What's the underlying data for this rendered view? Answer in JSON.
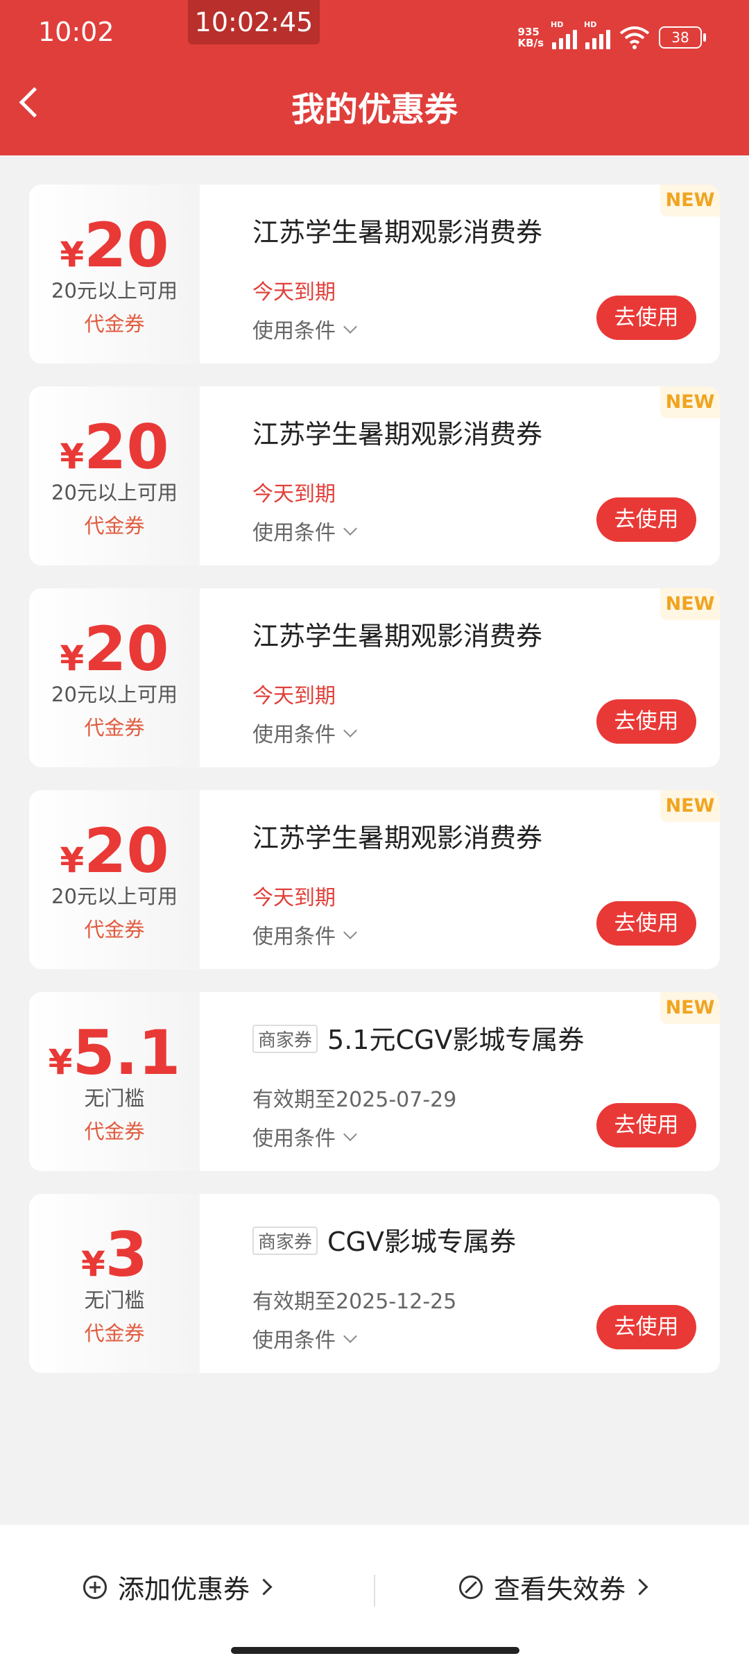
{
  "status_bar": {
    "time": "10:02",
    "clock_overlay": "10:02:45",
    "net_speed_value": "935",
    "net_speed_unit": "KB/s",
    "signal_label": "HD",
    "battery": "38"
  },
  "header": {
    "title": "我的优惠券"
  },
  "coupons": [
    {
      "yen": "¥",
      "amount": "20",
      "threshold": "20元以上可用",
      "type": "代金券",
      "title": "江苏学生暑期观影消费券",
      "expiry": "今天到期",
      "conditions": "使用条件",
      "button": "去使用",
      "badge": "NEW"
    },
    {
      "yen": "¥",
      "amount": "20",
      "threshold": "20元以上可用",
      "type": "代金券",
      "title": "江苏学生暑期观影消费券",
      "expiry": "今天到期",
      "conditions": "使用条件",
      "button": "去使用",
      "badge": "NEW"
    },
    {
      "yen": "¥",
      "amount": "20",
      "threshold": "20元以上可用",
      "type": "代金券",
      "title": "江苏学生暑期观影消费券",
      "expiry": "今天到期",
      "conditions": "使用条件",
      "button": "去使用",
      "badge": "NEW"
    },
    {
      "yen": "¥",
      "amount": "20",
      "threshold": "20元以上可用",
      "type": "代金券",
      "title": "江苏学生暑期观影消费券",
      "expiry": "今天到期",
      "conditions": "使用条件",
      "button": "去使用",
      "badge": "NEW"
    },
    {
      "yen": "¥",
      "amount": "5.1",
      "threshold": "无门槛",
      "type": "代金券",
      "tag": "商家券",
      "title": "5.1元CGV影城专属券",
      "expiry": "有效期至2025-07-29",
      "conditions": "使用条件",
      "button": "去使用",
      "badge": "NEW"
    },
    {
      "yen": "¥",
      "amount": "3",
      "threshold": "无门槛",
      "type": "代金券",
      "tag": "商家券",
      "title": "CGV影城专属券",
      "expiry": "有效期至2025-12-25",
      "conditions": "使用条件",
      "button": "去使用"
    }
  ],
  "footer": {
    "add_label": "添加优惠券",
    "invalid_label": "查看失效券"
  },
  "colors": {
    "header_red": "#e03e3b",
    "accent_red": "#e93936",
    "badge_orange": "#f0a41f"
  }
}
